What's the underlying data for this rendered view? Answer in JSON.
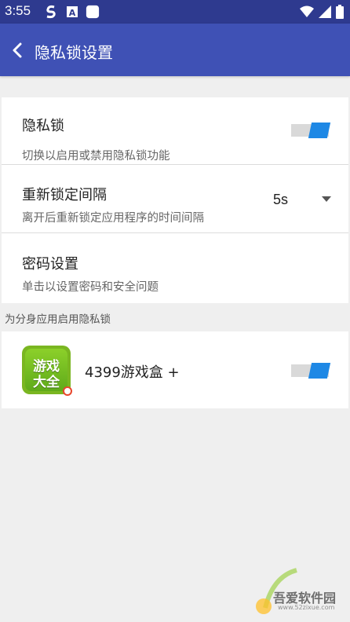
{
  "status_bar": {
    "time": "3:55",
    "icons": [
      "s-app-icon",
      "a-font-icon",
      "square-app-icon",
      "wifi-icon",
      "signal-icon",
      "battery-icon"
    ]
  },
  "app_bar": {
    "title": "隐私锁设置",
    "back_icon": "chevron-left-icon"
  },
  "settings": {
    "privacy_lock": {
      "title": "隐私锁",
      "subtitle": "切换以启用或禁用隐私锁功能",
      "enabled": true
    },
    "relock_interval": {
      "title": "重新锁定间隔",
      "subtitle": "离开后重新锁定应用程序的时间间隔",
      "value": "5s"
    },
    "password": {
      "title": "密码设置",
      "subtitle": "单击以设置密码和安全问题"
    }
  },
  "section_header": "为分身应用启用隐私锁",
  "apps": [
    {
      "name": "4399游戏盒 +",
      "icon_text_1": "游戏",
      "icon_text_2": "大全",
      "enabled": true
    }
  ],
  "watermark": {
    "text_cn": "吾爱软件园",
    "text_url": "www.52zixue.com"
  },
  "colors": {
    "status_bar": "#2e3a8f",
    "app_bar": "#3f51b5",
    "toggle_on": "#1e88e5",
    "background": "#efefef"
  }
}
